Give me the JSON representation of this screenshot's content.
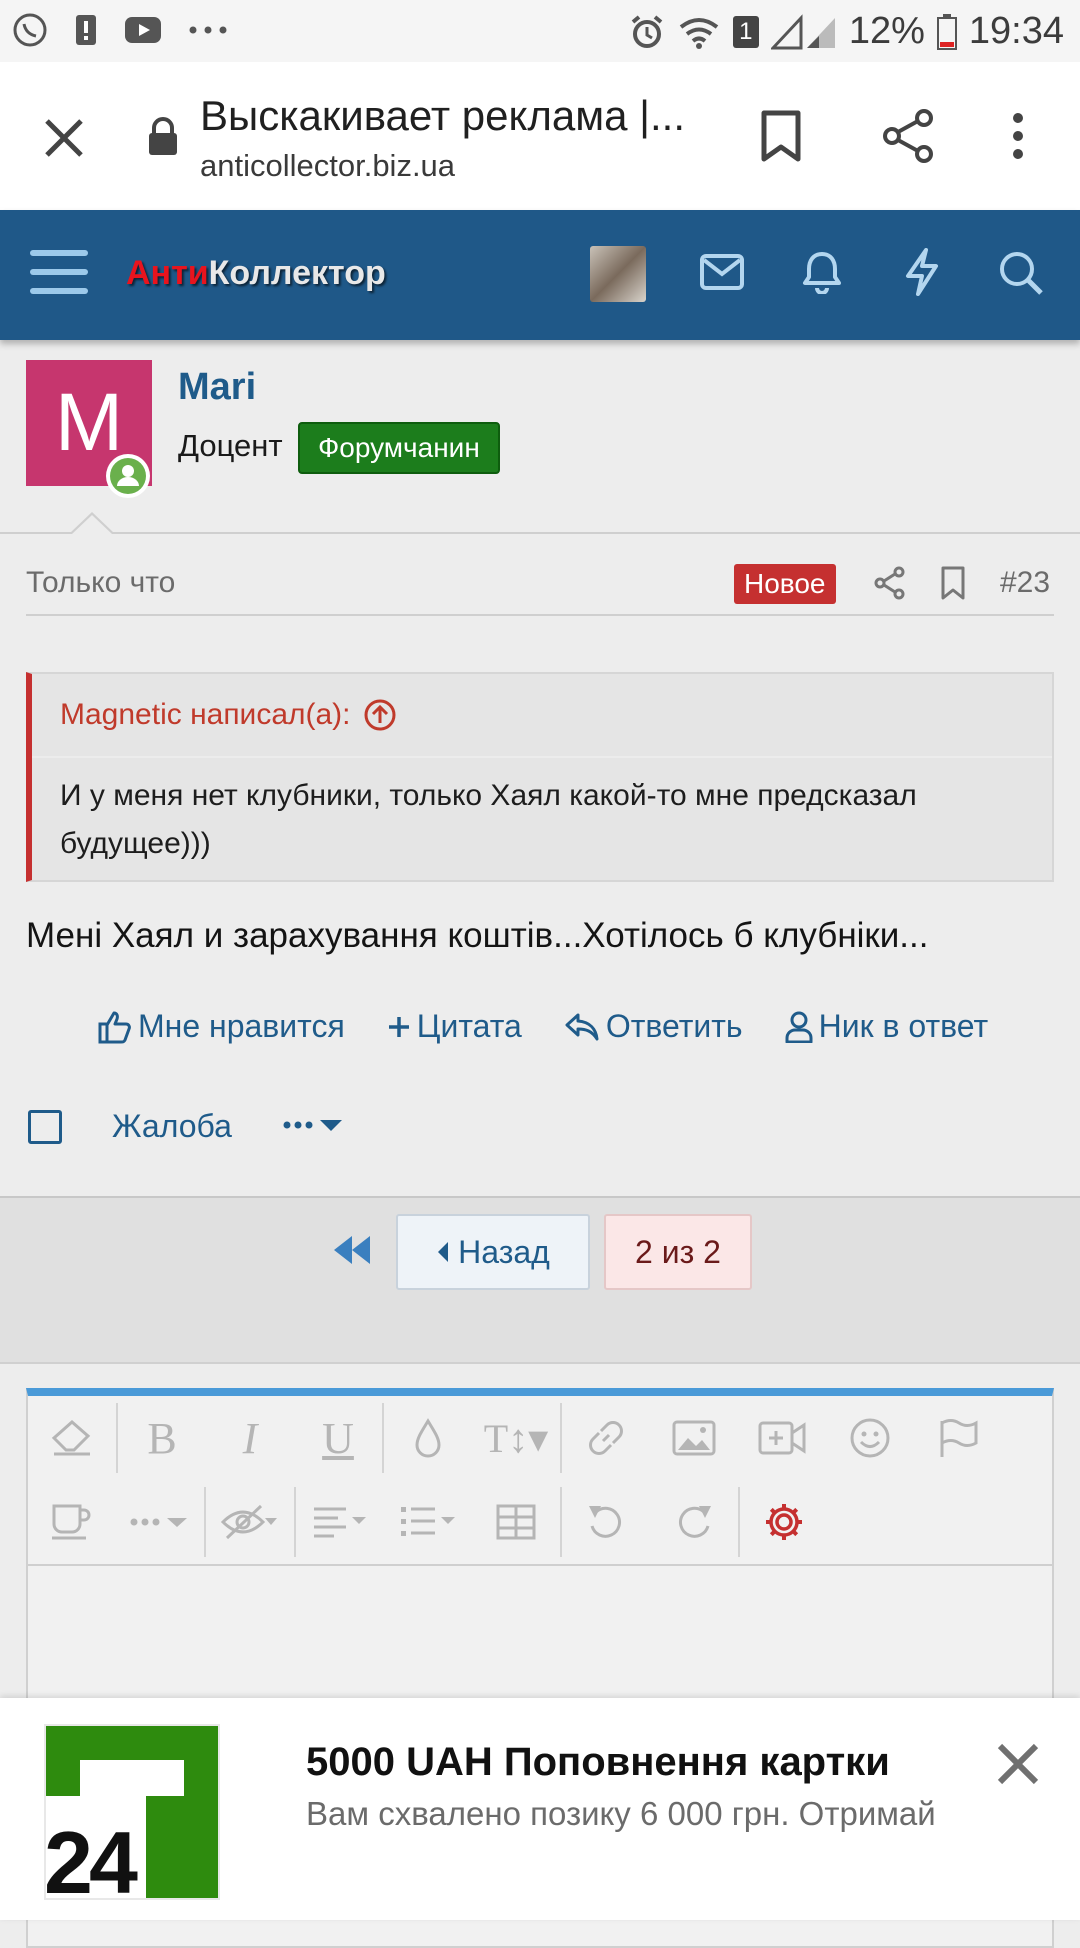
{
  "status_bar": {
    "battery_percent": "12%",
    "time": "19:34",
    "sim_number": "1",
    "left_icons": [
      "viber-icon",
      "alert-icon",
      "youtube-icon",
      "more-dots-icon"
    ],
    "right_icons": [
      "alarm-icon",
      "wifi-icon",
      "signal-icon",
      "battery-icon"
    ]
  },
  "browser": {
    "page_title": "Выскакивает реклама |...",
    "domain": "anticollector.biz.ua"
  },
  "forum_header": {
    "logo_part1": "Анти",
    "logo_part2": "Коллектор"
  },
  "post": {
    "avatar_letter": "M",
    "author": "Mari",
    "rank": "Доцент",
    "badge": "Форумчанин",
    "time": "Только что",
    "new_label": "Новое",
    "post_number": "#23",
    "quote": {
      "author_line": "Magnetic написал(а):",
      "text": "И у меня нет клубники, только Хаял какой-то мне предсказал будущее)))"
    },
    "message": "Мені Хаял и зарахування коштів...Хотілось б клубніки...",
    "actions": {
      "like": "Мне нравится",
      "quote": "Цитата",
      "reply": "Ответить",
      "nick": "Ник в ответ"
    },
    "report": "Жалоба"
  },
  "pagination": {
    "back": "Назад",
    "page": "2 из 2"
  },
  "ad": {
    "logo_text": "24",
    "title": "5000 UAH Поповнення картки",
    "description": "Вам схвалено позику 6 000 грн. Отримай"
  },
  "colors": {
    "header_blue": "#1f5888",
    "link_blue": "#1f5b8a",
    "accent_red": "#c53030",
    "badge_green": "#1c7d1c",
    "avatar_pink": "#c6366e",
    "editor_top_blue": "#4a9ad8",
    "privat_green": "#2e8b0e"
  }
}
